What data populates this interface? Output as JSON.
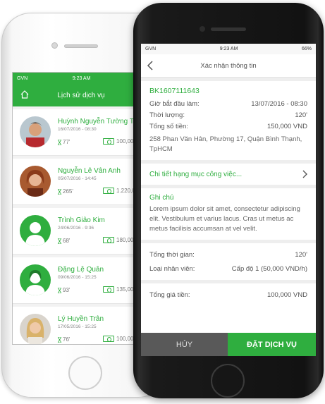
{
  "history_phone": {
    "status": {
      "carrier": "GVN",
      "time": "9:23 AM"
    },
    "title": "Lịch sử dịch vụ",
    "items": [
      {
        "name": "Huỳnh Nguyễn Tường Thi",
        "date": "16/07/2016 - 08:30",
        "duration": "77'",
        "price": "100,000 VND"
      },
      {
        "name": "Nguyễn Lê Vân Anh",
        "date": "05/07/2016 - 14:45",
        "duration": "265'",
        "price": "1.220,000"
      },
      {
        "name": "Trình Giảo Kim",
        "date": "24/06/2016 - 9:36",
        "duration": "68'",
        "price": "180,000 VN"
      },
      {
        "name": "Đặng Lệ Quân",
        "date": "09/06/2016 - 15:25",
        "duration": "93'",
        "price": "135,000 VN"
      },
      {
        "name": "Lý Huyền Trân",
        "date": "17/05/2016 - 15:25",
        "duration": "76'",
        "price": "100,000 VN"
      }
    ]
  },
  "confirm_phone": {
    "status": {
      "carrier": "GVN",
      "time": "9:23 AM",
      "battery": "66%"
    },
    "title": "Xác nhận thông tin",
    "booking_code": "BK1607111643",
    "start_label": "Giờ bắt đầu làm:",
    "start_value": "13/07/2016 - 08:30",
    "duration_label": "Thời lượng:",
    "duration_value": "120'",
    "total_label": "Tổng số tiền:",
    "total_value": "150,000 VND",
    "address": "258 Phan Văn Hân, Phường 17, Quận Bình Thạnh, TpHCM",
    "detail_link": "Chi tiết hạng mục công việc...",
    "note_title": "Ghi chú",
    "note_body": "Lorem ipsum dolor sit amet, consectetur adipiscing elit. Vestibulum et varius lacus. Cras ut metus ac metus facilisis accumsan at vel velit.",
    "total_time_label": "Tổng thời gian:",
    "total_time_value": "120'",
    "staff_label": "Loại nhân viên:",
    "staff_value": "Cấp độ 1 (50,000 VND/h)",
    "grand_total_label": "Tổng giá tiền:",
    "grand_total_value": "100,000 VND",
    "cancel_label": "HỦY",
    "book_label": "ĐẶT DỊCH VỤ"
  },
  "colors": {
    "accent": "#2fae3f",
    "cancel_bg": "#595959"
  }
}
